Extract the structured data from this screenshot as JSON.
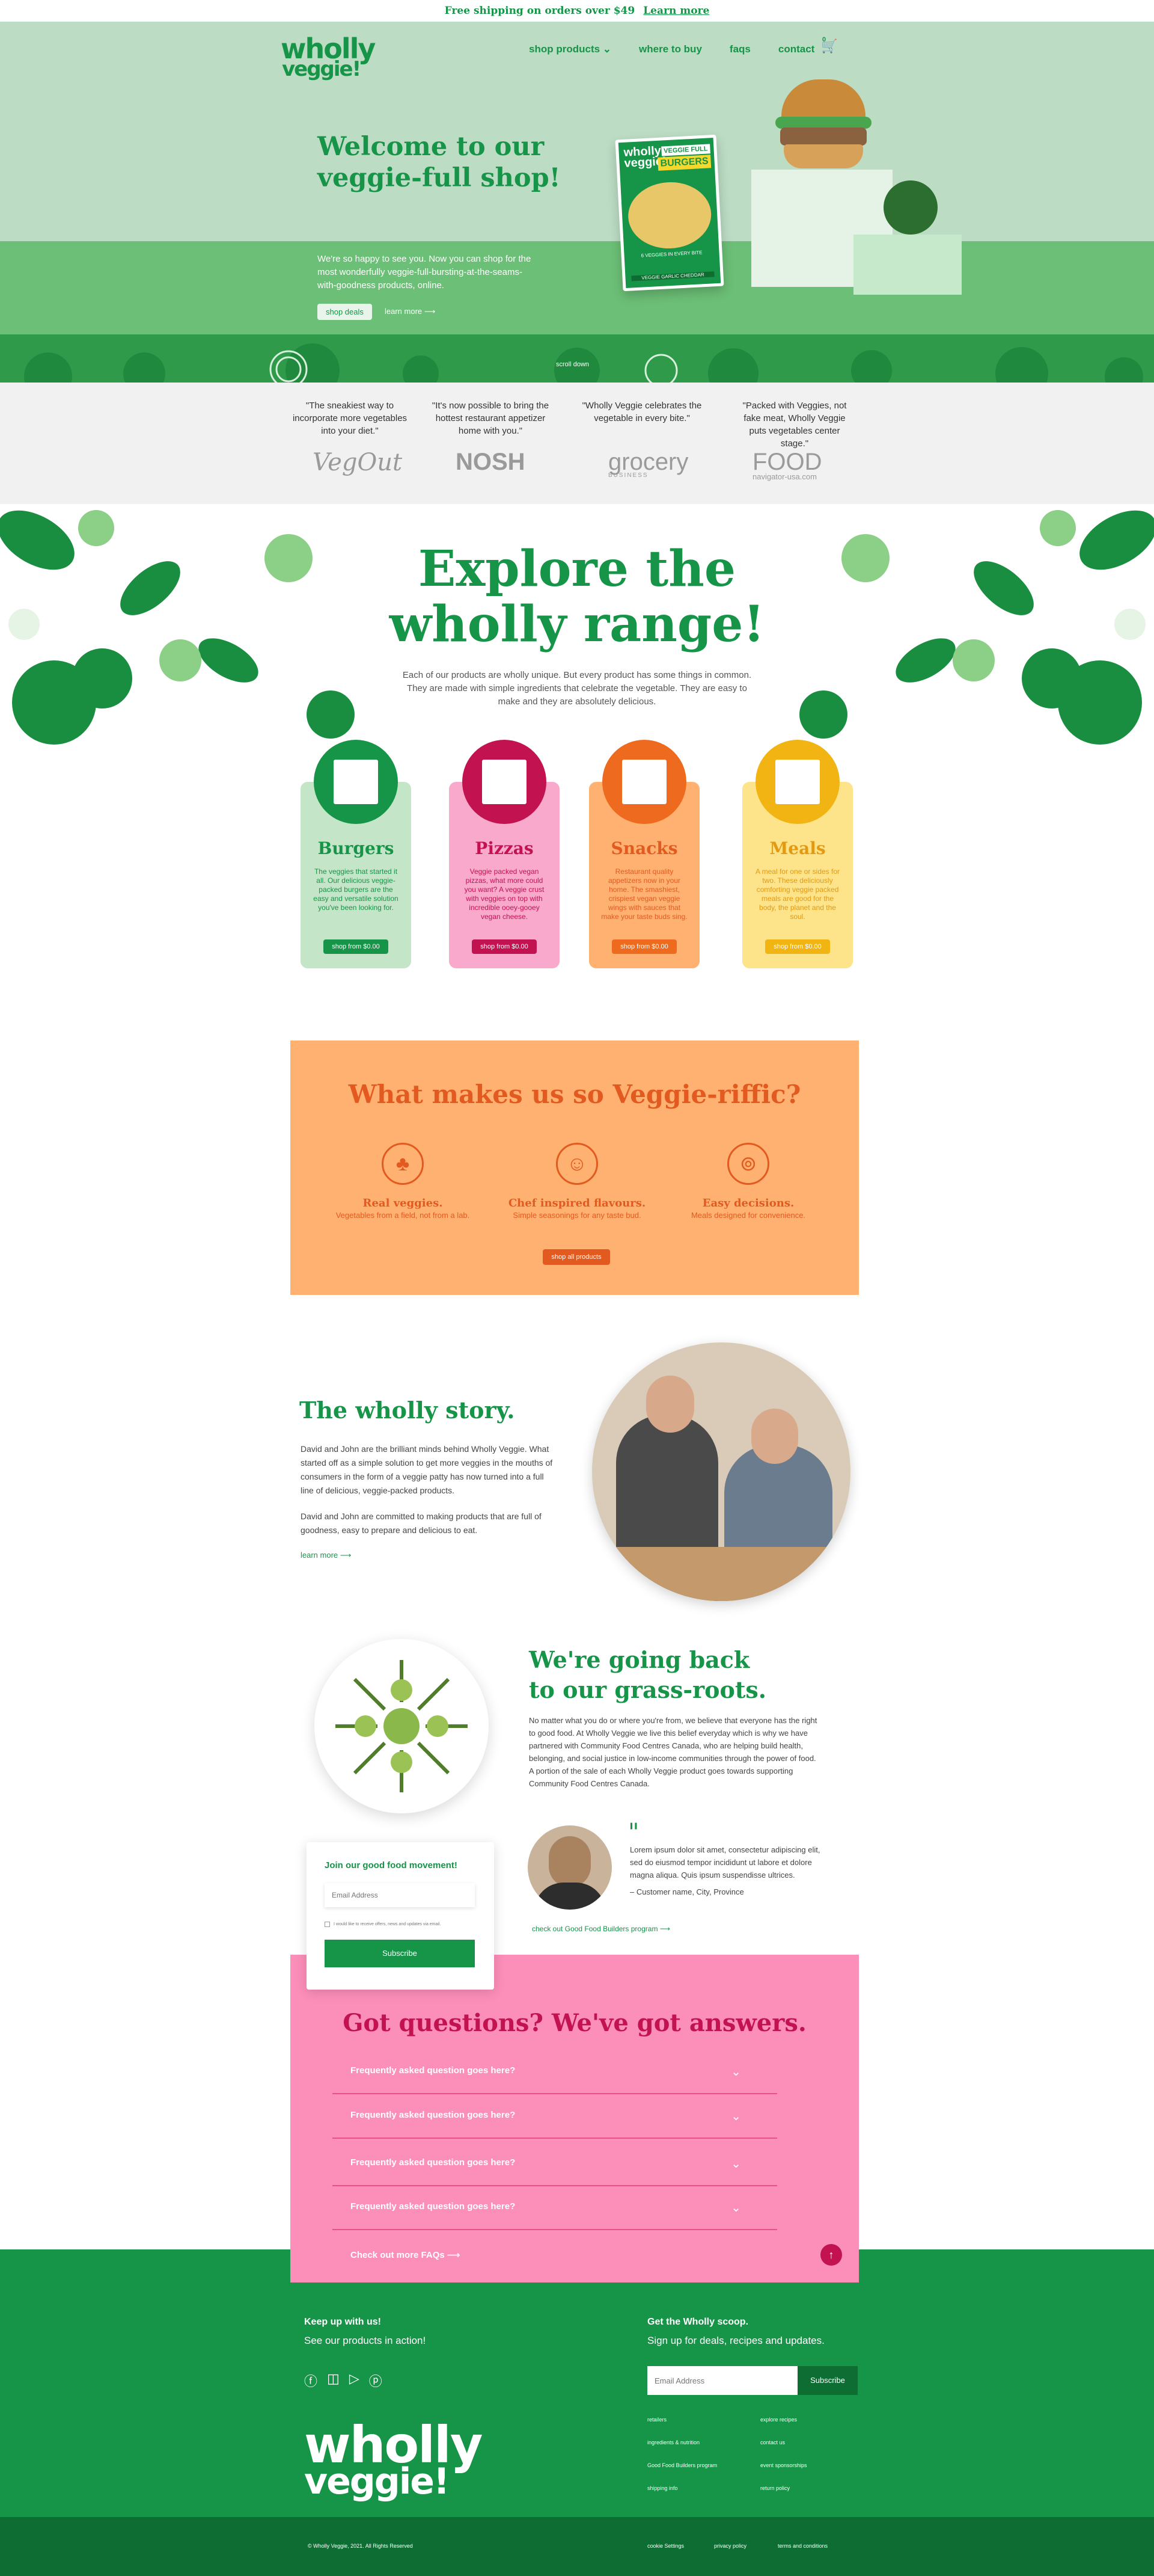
{
  "topbar": {
    "text": "Free shipping on orders over $49",
    "link": "Learn more"
  },
  "brand": {
    "line1": "wholly",
    "line2": "veggie!"
  },
  "nav": {
    "items": [
      "shop products",
      "where to buy",
      "faqs",
      "contact"
    ],
    "cart_count": "0"
  },
  "hero": {
    "title": "Welcome to our veggie-full shop!",
    "copy": "We're so happy to see you. Now you can shop for the most wonderfully veggie-full-bursting-at-the-seams-with-goodness products, online.",
    "btn_deals": "shop deals",
    "btn_learn": "learn more",
    "scroll_down": "scroll down",
    "pack_line1": "VEGGIE FULL",
    "pack_line2": "BURGERS",
    "pack_tag": "6 VEGGIES IN EVERY BITE",
    "pack_variety": "VEGGIE GARLIC CHEDDAR"
  },
  "press": {
    "quotes": [
      "\"The sneakiest way to incorporate more vegetables into your diet.\"",
      "\"It's now possible to bring the hottest restaurant appetizer home with you.\"",
      "\"Wholly Veggie celebrates the vegetable in every bite.\"",
      "\"Packed with Veggies, not fake meat, Wholly Veggie puts vegetables center stage.\""
    ],
    "logos": [
      "VegOut",
      "NOSH",
      "grocery",
      "FOOD"
    ],
    "logo_sub": [
      "BUSINESS",
      "navigator-usa.com"
    ]
  },
  "explore": {
    "title_line1": "Explore the",
    "title_line2": "wholly range!",
    "copy": "Each of our products are wholly unique. But every product has some things in common. They are made with simple ingredients that celebrate the vegetable. They are easy to make and they are absolutely delicious.",
    "cards": [
      {
        "title": "Burgers",
        "copy": "The veggies that started it all. Our delicious veggie-packed burgers are the easy and versatile solution you've been looking for.",
        "btn": "shop from $0.00"
      },
      {
        "title": "Pizzas",
        "copy": "Veggie packed vegan pizzas, what more could you want? A veggie crust with veggies on top with incredible ooey-gooey vegan cheese.",
        "btn": "shop from $0.00"
      },
      {
        "title": "Snacks",
        "copy": "Restaurant quality appetizers now in your home. The smashiest, crispiest vegan veggie wings with sauces that make your taste buds sing.",
        "btn": "shop from $0.00"
      },
      {
        "title": "Meals",
        "copy": "A meal for one or sides for two. These deliciously comforting veggie packed meals are good for the body, the planet and the soul.",
        "btn": "shop from $0.00"
      }
    ]
  },
  "riffic": {
    "title": "What makes us so Veggie-riffic?",
    "features": [
      {
        "title": "Real veggies.",
        "copy": "Vegetables from a field, not from a lab."
      },
      {
        "title": "Chef inspired flavours.",
        "copy": "Simple seasonings for any taste bud."
      },
      {
        "title": "Easy decisions.",
        "copy": "Meals designed for convenience."
      }
    ],
    "btn": "shop all products"
  },
  "story": {
    "title": "The wholly story.",
    "p1": "David and John are the brilliant minds behind Wholly Veggie. What started off as a simple solution to get more veggies in the mouths of consumers in the form of a veggie patty has now turned into a full line of delicious, veggie-packed products.",
    "p2": "David and John are committed to making products that are full of goodness, easy to prepare and delicious to eat.",
    "link": "learn more"
  },
  "roots": {
    "title_line1": "We're going back",
    "title_line2": "to our grass-roots.",
    "copy": "No matter what you do or where you're from, we believe that everyone has the right to good food. At Wholly Veggie we live this belief everyday which is why we have partnered with Community Food Centres Canada, who are helping build health, belonging, and social justice in low-income communities through the power of food. A portion of the sale of each Wholly Veggie product goes towards supporting Community Food Centres Canada.",
    "quote": "Lorem ipsum dolor sit amet, consectetur adipiscing elit, sed do eiusmod tempor incididunt ut labore et dolore magna aliqua. Quis ipsum suspendisse ultrices.",
    "quote_name": "– Customer name, City, Province",
    "link": "check out Good Food Builders program"
  },
  "join": {
    "title": "Join our good food movement!",
    "placeholder": "Email Address",
    "consent": "I would like to receive offers, news and updates via email.",
    "btn": "Subscribe"
  },
  "faq": {
    "title": "Got questions? We've got answers.",
    "items": [
      "Frequently asked question goes here?",
      "Frequently asked question goes here?",
      "Frequently asked question goes here?",
      "Frequently asked question goes here?"
    ],
    "more": "Check out more FAQs"
  },
  "footer": {
    "left_head": "Keep up with us!",
    "left_sub": "See our products in action!",
    "right_head": "Get the Wholly scoop.",
    "right_sub": "Sign up for deals, recipes and updates.",
    "email_placeholder": "Email Address",
    "subscribe": "Subscribe",
    "links_col1": [
      "retailers",
      "ingredients & nutrition",
      "Good Food Builders program",
      "shipping info"
    ],
    "links_col2": [
      "explore recipes",
      "contact us",
      "event sponsorships",
      "return policy"
    ],
    "copyright": "© Wholly Veggie, 2021. All Rights Reserved",
    "legal": [
      "cookie Settings",
      "privacy policy",
      "terms and conditions"
    ]
  },
  "colors": {
    "green": "#169448",
    "pink": "#fc8eba",
    "orange": "#ffb171",
    "crimson": "#c21350"
  }
}
